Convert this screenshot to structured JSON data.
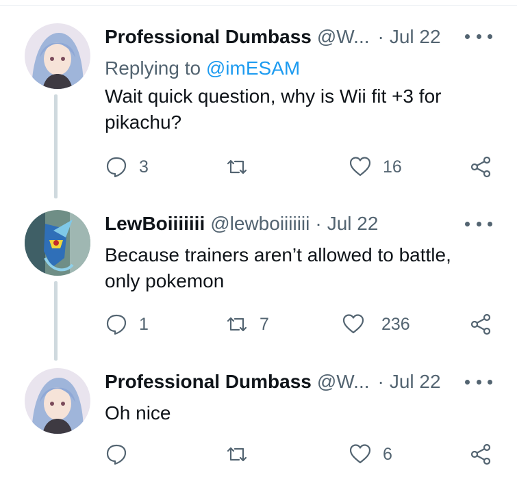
{
  "tweets": [
    {
      "name": "Professional Dumbass",
      "handle": "@W...",
      "date": "Jul 22",
      "replying_prefix": "Replying to ",
      "replying_to": "@imESAM",
      "text": "Wait quick question, why is Wii fit +3 for pikachu?",
      "reply_count": "3",
      "retweet_count": "",
      "like_count": "16"
    },
    {
      "name": "LewBoiiiiiii",
      "handle": "@lewboiiiiiii",
      "date": "Jul 22",
      "text": "Because trainers aren’t allowed to battle, only pokemon",
      "reply_count": "1",
      "retweet_count": "7",
      "like_count": "236"
    },
    {
      "name": "Professional Dumbass",
      "handle": "@W...",
      "date": "Jul 22",
      "text": "Oh nice",
      "reply_count": "",
      "retweet_count": "",
      "like_count": "6"
    }
  ],
  "separator": "·",
  "colors": {
    "accent": "#1d9bf0",
    "muted": "#536471",
    "text": "#0f1419",
    "line": "#cfd9de"
  }
}
